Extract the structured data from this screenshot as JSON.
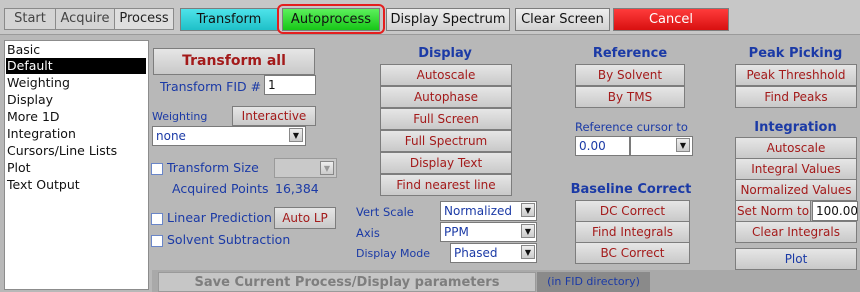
{
  "tabs": [
    "Start",
    "Acquire",
    "Process"
  ],
  "toolbar": {
    "transform": "Transform",
    "autoprocess": "Autoprocess",
    "display_spectrum": "Display Spectrum",
    "clear_screen": "Clear Screen",
    "cancel": "Cancel"
  },
  "sidebar": {
    "items": [
      "Basic",
      "Default",
      "Weighting",
      "Display",
      "More 1D",
      "Integration",
      "Cursors/Line Lists",
      "Plot",
      "Text Output"
    ],
    "selected": "Default"
  },
  "transform": {
    "transform_all": "Transform all",
    "fid_label": "Transform FID #",
    "fid_value": "1",
    "weighting_label": "Weighting",
    "interactive": "Interactive",
    "weighting_value": "none",
    "transform_size_label": "Transform Size",
    "acquired_points_label": "Acquired Points",
    "acquired_points_value": "16,384",
    "linear_prediction_label": "Linear Prediction",
    "auto_lp": "Auto LP",
    "solvent_subtraction_label": "Solvent Subtraction"
  },
  "display": {
    "header": "Display",
    "buttons": [
      "Autoscale",
      "Autophase",
      "Full Screen",
      "Full Spectrum",
      "Display Text",
      "Find nearest line"
    ],
    "vert_scale_label": "Vert Scale",
    "vert_scale_value": "Normalized",
    "axis_label": "Axis",
    "axis_value": "PPM",
    "display_mode_label": "Display Mode",
    "display_mode_value": "Phased"
  },
  "reference": {
    "header": "Reference",
    "by_solvent": "By Solvent",
    "by_tms": "By TMS",
    "cursor_label": "Reference cursor to",
    "cursor_value": "0.00"
  },
  "baseline": {
    "header": "Baseline Correct",
    "buttons": [
      "DC Correct",
      "Find Integrals",
      "BC Correct"
    ]
  },
  "peak_picking": {
    "header": "Peak Picking",
    "buttons": [
      "Peak Threshhold",
      "Find Peaks"
    ]
  },
  "integration": {
    "header": "Integration",
    "buttons": [
      "Autoscale",
      "Integral Values",
      "Normalized Values"
    ],
    "set_norm_label": "Set Norm to",
    "set_norm_value": "100.00",
    "clear_integrals": "Clear Integrals"
  },
  "plot": "Plot",
  "footer": {
    "save": "Save Current Process/Display parameters",
    "fid_dir": "(in FID directory)"
  },
  "colors": {
    "accent_blue": "#1b3aa6",
    "button_red_text": "#a31a1a",
    "autoprocess_green": "#22d622",
    "transform_cyan": "#2ad0d8",
    "cancel_red": "#e01919"
  }
}
